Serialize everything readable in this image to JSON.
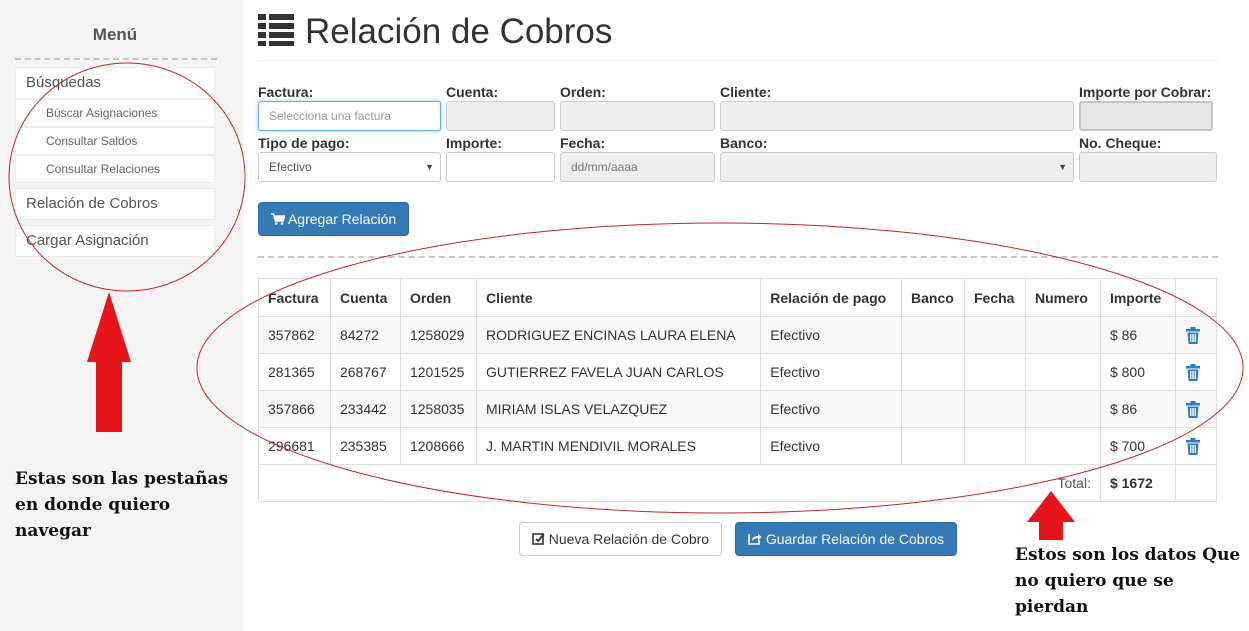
{
  "sidebar": {
    "title": "Menú",
    "items": [
      {
        "label": "Búsquedas"
      },
      {
        "label": "Relación de Cobros"
      },
      {
        "label": "Cargar Asignación"
      }
    ],
    "subitems": [
      {
        "label": "Búscar Asignaciones"
      },
      {
        "label": "Consultar Saldos"
      },
      {
        "label": "Consultar Relaciones"
      }
    ]
  },
  "header": {
    "title": "Relación de Cobros",
    "icon": "list-icon"
  },
  "form": {
    "factura_label": "Factura:",
    "factura_placeholder": "Selecciona una factura",
    "cuenta_label": "Cuenta:",
    "orden_label": "Orden:",
    "cliente_label": "Cliente:",
    "importe_cobrar_label": "Importe por Cobrar:",
    "tipo_pago_label": "Tipo de pago:",
    "tipo_pago_value": "Efectivo",
    "importe_label": "Importe:",
    "fecha_label": "Fecha:",
    "fecha_placeholder": "dd/mm/aaaa",
    "banco_label": "Banco:",
    "cheque_label": "No. Cheque:",
    "agregar_button": "Agregar Relación"
  },
  "table": {
    "columns": [
      "Factura",
      "Cuenta",
      "Orden",
      "Cliente",
      "Relación de pago",
      "Banco",
      "Fecha",
      "Numero",
      "Importe"
    ],
    "rows": [
      {
        "factura": "357862",
        "cuenta": "84272",
        "orden": "1258029",
        "cliente": "RODRIGUEZ ENCINAS LAURA ELENA",
        "relacion": "Efectivo",
        "banco": "",
        "fecha": "",
        "numero": "",
        "importe": "$ 86"
      },
      {
        "factura": "281365",
        "cuenta": "268767",
        "orden": "1201525",
        "cliente": "GUTIERREZ FAVELA JUAN CARLOS",
        "relacion": "Efectivo",
        "banco": "",
        "fecha": "",
        "numero": "",
        "importe": "$ 800"
      },
      {
        "factura": "357866",
        "cuenta": "233442",
        "orden": "1258035",
        "cliente": "MIRIAM ISLAS VELAZQUEZ",
        "relacion": "Efectivo",
        "banco": "",
        "fecha": "",
        "numero": "",
        "importe": "$ 86"
      },
      {
        "factura": "296681",
        "cuenta": "235385",
        "orden": "1208666",
        "cliente": "J. MARTIN MENDIVIL MORALES",
        "relacion": "Efectivo",
        "banco": "",
        "fecha": "",
        "numero": "",
        "importe": "$ 700"
      }
    ],
    "total_label": "Total:",
    "total_value": "$ 1672"
  },
  "actions": {
    "nueva_button": "Nueva Relación de Cobro",
    "guardar_button": "Guardar Relación de Cobros"
  },
  "annotations": {
    "left_note": [
      "Estas son las pestañas",
      "en donde quiero",
      "navegar"
    ],
    "right_note": [
      "Estos son los datos Que",
      "no quiero que se",
      "pierdan"
    ]
  },
  "colors": {
    "primary": "#337ab7",
    "annotation_red": "#e8141c",
    "ellipse": "#c0282d"
  }
}
